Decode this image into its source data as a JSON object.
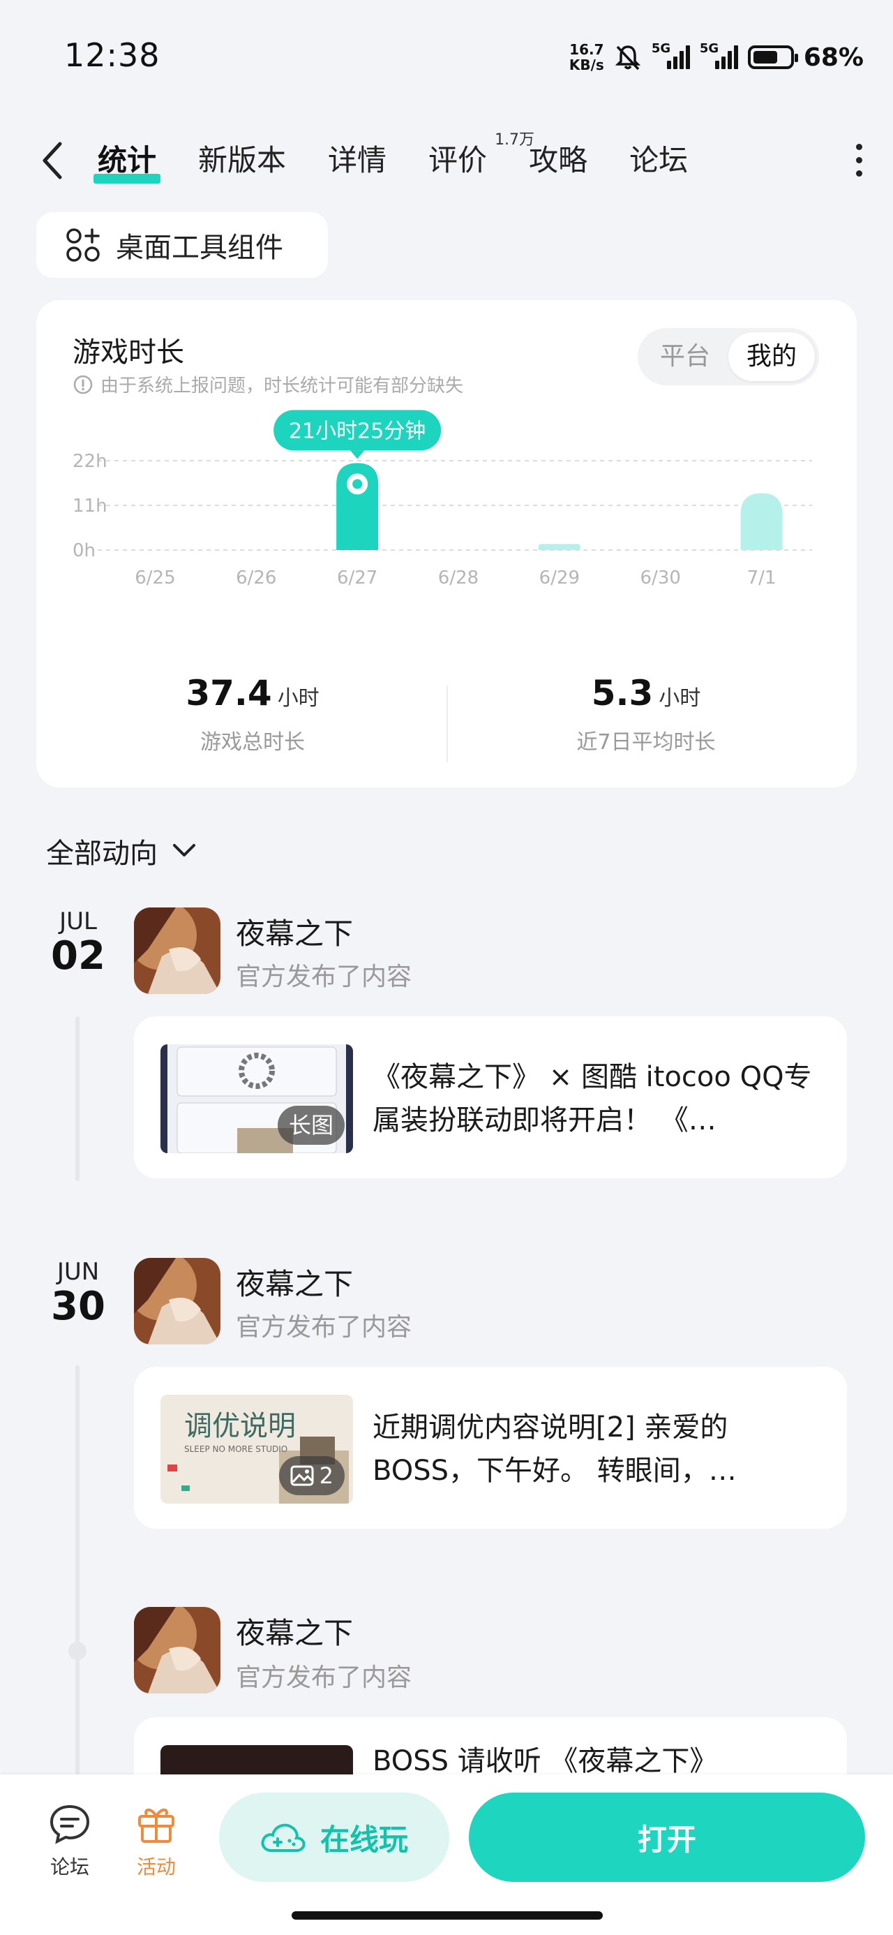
{
  "status": {
    "time": "12:38",
    "net_speed_value": "16.7",
    "net_speed_unit": "KB/s",
    "signal1": "5G",
    "signal2": "5G",
    "battery_pct": "68%",
    "battery_level": 0.68
  },
  "nav": {
    "tabs": [
      "统计",
      "新版本",
      "详情",
      "评价",
      "攻略",
      "论坛"
    ],
    "review_count": "1.7万"
  },
  "widget_chip": {
    "label": "桌面工具组件"
  },
  "stats": {
    "title": "游戏时长",
    "note": "由于系统上报问题，时长统计可能有部分缺失",
    "segments": [
      "平台",
      "我的"
    ],
    "tooltip": "21小时25分钟",
    "total_value": "37.4",
    "total_unit": "小时",
    "total_label": "游戏总时长",
    "avg_value": "5.3",
    "avg_unit": "小时",
    "avg_label": "近7日平均时长"
  },
  "chart_data": {
    "type": "bar",
    "categories": [
      "6/25",
      "6/26",
      "6/27",
      "6/28",
      "6/29",
      "6/30",
      "7/1"
    ],
    "values": [
      0,
      0,
      21.42,
      0,
      1.5,
      0,
      14
    ],
    "highlight_index": 2,
    "yticks": [
      "0h",
      "11h",
      "22h"
    ],
    "ylim": [
      0,
      22
    ],
    "grid": true,
    "colors": {
      "primary": "#1dd4be",
      "light": "#b5f1ea"
    }
  },
  "feed": {
    "filter_label": "全部动向",
    "groups": [
      {
        "mon": "JUL",
        "day": "02",
        "name": "夜幕之下",
        "sub": "官方发布了内容",
        "post_text": "《夜幕之下》 × 图酷 itocoo QQ专属装扮联动即将开启！ 《…",
        "badge": "长图"
      },
      {
        "mon": "JUN",
        "day": "30",
        "name": "夜幕之下",
        "sub": "官方发布了内容",
        "post_text": "近期调优内容说明[2] 亲爱的BOSS，下午好。 转眼间，…",
        "badge": "2",
        "thumb_title": "调优说明",
        "thumb_sub": "SLEEP NO MORE STUDIO"
      },
      {
        "name": "夜幕之下",
        "sub": "官方发布了内容",
        "post_text": "BOSS 请收听 《夜幕之下》"
      }
    ]
  },
  "bottom": {
    "forum_label": "论坛",
    "activity_label": "活动",
    "online_label": "在线玩",
    "open_label": "打开"
  }
}
